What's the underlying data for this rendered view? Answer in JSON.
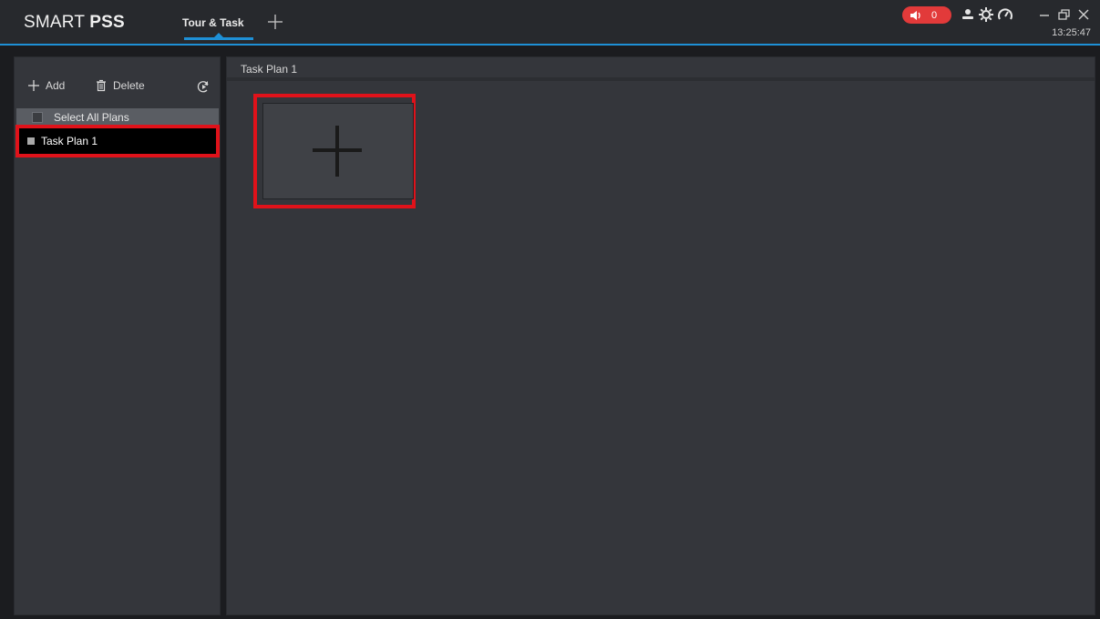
{
  "app": {
    "logo_light": "SMART ",
    "logo_bold": "PSS",
    "active_tab": "Tour & Task",
    "alarm_count": "0",
    "clock": "13:25:47"
  },
  "colors": {
    "accent": "#1e90d6",
    "alarm": "#e23a3a",
    "highlight": "#e0121a"
  },
  "left_panel": {
    "add_label": "Add",
    "delete_label": "Delete",
    "select_all_label": "Select All Plans",
    "plans": [
      {
        "label": "Task Plan 1",
        "selected": true
      }
    ]
  },
  "main_panel": {
    "header": "Task Plan 1"
  },
  "icons": [
    "plus-icon",
    "speaker-icon",
    "user-icon",
    "gear-icon",
    "dashboard-icon",
    "minimize-icon",
    "restore-icon",
    "close-icon",
    "trash-icon",
    "refresh-play-icon"
  ]
}
